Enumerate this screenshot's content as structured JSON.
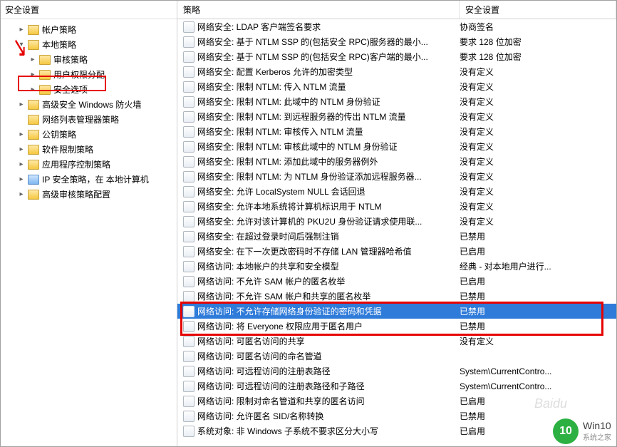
{
  "tree": {
    "header": "安全设置",
    "nodes": [
      {
        "label": "帐户策略",
        "depth": 1,
        "expandable": true
      },
      {
        "label": "本地策略",
        "depth": 1,
        "expandable": true,
        "expanded": true
      },
      {
        "label": "审核策略",
        "depth": 2,
        "expandable": true
      },
      {
        "label": "用户权限分配",
        "depth": 2,
        "expandable": true
      },
      {
        "label": "安全选项",
        "depth": 2,
        "expandable": true
      },
      {
        "label": "高级安全 Windows 防火墙",
        "depth": 1,
        "expandable": true
      },
      {
        "label": "网络列表管理器策略",
        "depth": 1,
        "expandable": false
      },
      {
        "label": "公钥策略",
        "depth": 1,
        "expandable": true
      },
      {
        "label": "软件限制策略",
        "depth": 1,
        "expandable": true
      },
      {
        "label": "应用程序控制策略",
        "depth": 1,
        "expandable": true
      },
      {
        "label": "IP 安全策略，在 本地计算机",
        "depth": 1,
        "expandable": true,
        "icon": "ip"
      },
      {
        "label": "高级审核策略配置",
        "depth": 1,
        "expandable": true
      }
    ]
  },
  "list": {
    "headers": {
      "policy": "策略",
      "setting": "安全设置"
    },
    "rows": [
      {
        "policy": "网络安全: LDAP 客户端签名要求",
        "setting": "协商签名"
      },
      {
        "policy": "网络安全: 基于 NTLM SSP 的(包括安全 RPC)服务器的最小...",
        "setting": "要求 128 位加密"
      },
      {
        "policy": "网络安全: 基于 NTLM SSP 的(包括安全 RPC)客户端的最小...",
        "setting": "要求 128 位加密"
      },
      {
        "policy": "网络安全: 配置 Kerberos 允许的加密类型",
        "setting": "没有定义"
      },
      {
        "policy": "网络安全: 限制 NTLM: 传入 NTLM 流量",
        "setting": "没有定义"
      },
      {
        "policy": "网络安全: 限制 NTLM: 此域中的 NTLM 身份验证",
        "setting": "没有定义"
      },
      {
        "policy": "网络安全: 限制 NTLM: 到远程服务器的传出 NTLM 流量",
        "setting": "没有定义"
      },
      {
        "policy": "网络安全: 限制 NTLM: 审核传入 NTLM 流量",
        "setting": "没有定义"
      },
      {
        "policy": "网络安全: 限制 NTLM: 审核此域中的 NTLM 身份验证",
        "setting": "没有定义"
      },
      {
        "policy": "网络安全: 限制 NTLM: 添加此域中的服务器例外",
        "setting": "没有定义"
      },
      {
        "policy": "网络安全: 限制 NTLM: 为 NTLM 身份验证添加远程服务器...",
        "setting": "没有定义"
      },
      {
        "policy": "网络安全: 允许 LocalSystem NULL 会话回退",
        "setting": "没有定义"
      },
      {
        "policy": "网络安全: 允许本地系统将计算机标识用于 NTLM",
        "setting": "没有定义"
      },
      {
        "policy": "网络安全: 允许对该计算机的 PKU2U 身份验证请求使用联...",
        "setting": "没有定义"
      },
      {
        "policy": "网络安全: 在超过登录时间后强制注销",
        "setting": "已禁用"
      },
      {
        "policy": "网络安全: 在下一次更改密码时不存储 LAN 管理器哈希值",
        "setting": "已启用"
      },
      {
        "policy": "网络访问: 本地帐户的共享和安全模型",
        "setting": "经典 - 对本地用户进行..."
      },
      {
        "policy": "网络访问: 不允许 SAM 帐户的匿名枚举",
        "setting": "已启用"
      },
      {
        "policy": "网络访问: 不允许 SAM 帐户和共享的匿名枚举",
        "setting": "已禁用"
      },
      {
        "policy": "网络访问: 不允许存储网络身份验证的密码和凭据",
        "setting": "已禁用",
        "selected": true
      },
      {
        "policy": "网络访问: 将 Everyone 权限应用于匿名用户",
        "setting": "已禁用"
      },
      {
        "policy": "网络访问: 可匿名访问的共享",
        "setting": "没有定义"
      },
      {
        "policy": "网络访问: 可匿名访问的命名管道",
        "setting": ""
      },
      {
        "policy": "网络访问: 可远程访问的注册表路径",
        "setting": "System\\CurrentContro..."
      },
      {
        "policy": "网络访问: 可远程访问的注册表路径和子路径",
        "setting": "System\\CurrentContro..."
      },
      {
        "policy": "网络访问: 限制对命名管道和共享的匿名访问",
        "setting": "已启用"
      },
      {
        "policy": "网络访问: 允许匿名 SID/名称转换",
        "setting": "已禁用"
      },
      {
        "policy": "系统对象: 非 Windows 子系统不要求区分大小写",
        "setting": "已启用"
      }
    ]
  },
  "watermark": {
    "badge": "10",
    "line1": "Win10",
    "line2": "系统之家",
    "baidu": "Baidu"
  }
}
